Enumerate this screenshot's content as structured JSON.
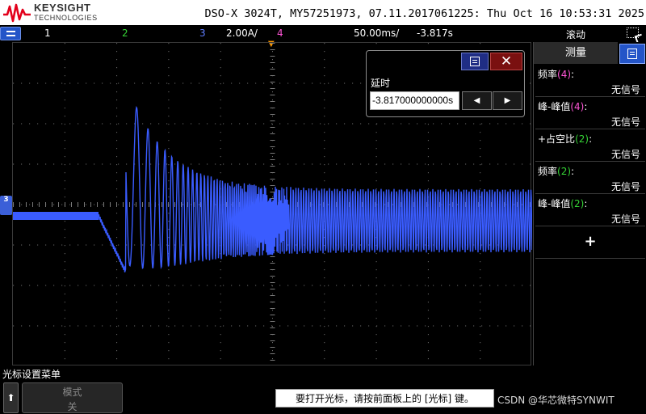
{
  "title_bar": {
    "brand": "KEYSIGHT",
    "brand_sub": "TECHNOLOGIES",
    "model_line": "DSO-X 3024T, MY57251973, 07.11.2017061225: Thu Oct 16 10:53:31 2025"
  },
  "status_bar": {
    "ch1": "1",
    "ch2": "2",
    "ch3": "3",
    "ch3_scale": "2.00A/",
    "ch4": "4",
    "timebase": "50.00ms/",
    "delay": "-3.817s",
    "run_mode": "滚动"
  },
  "markers": {
    "trigger": "▼",
    "ch3": "3"
  },
  "delay_popup": {
    "label": "延时",
    "value": "-3.817000000000s",
    "close_label": "✕",
    "left_arrow": "◀",
    "right_arrow": "▶"
  },
  "measure_panel": {
    "title": "测量",
    "items": [
      {
        "name": "频率",
        "channel": "(4)",
        "channel_color": "#ff55d6",
        "suffix": ":",
        "value": "无信号"
      },
      {
        "name": "峰-峰值",
        "channel": "(4)",
        "channel_color": "#ff55d6",
        "suffix": ":",
        "value": "无信号"
      },
      {
        "name": "+占空比",
        "channel": "(2)",
        "channel_color": "#35d435",
        "suffix": ":",
        "value": "无信号"
      },
      {
        "name": "频率",
        "channel": "(2)",
        "channel_color": "#35d435",
        "suffix": ":",
        "value": "无信号"
      },
      {
        "name": "峰-峰值",
        "channel": "(2)",
        "channel_color": "#35d435",
        "suffix": ":",
        "value": "无信号"
      }
    ],
    "add_label": "+"
  },
  "bottom": {
    "menu_name": "光标设置菜单",
    "up_arrow": "⬆",
    "softkey1_label": "模式",
    "softkey1_value": "关",
    "hint": "要打开光标，请按前面板上的 [光标] 键。",
    "watermark": "CSDN @华芯微特SYNWIT"
  },
  "colors": {
    "trace": "#3a5cff",
    "ch1": "#ffffff",
    "ch2": "#35d435",
    "ch3": "#5f7dff",
    "ch4": "#ff55d6",
    "accent_blue": "#2455c8"
  }
}
